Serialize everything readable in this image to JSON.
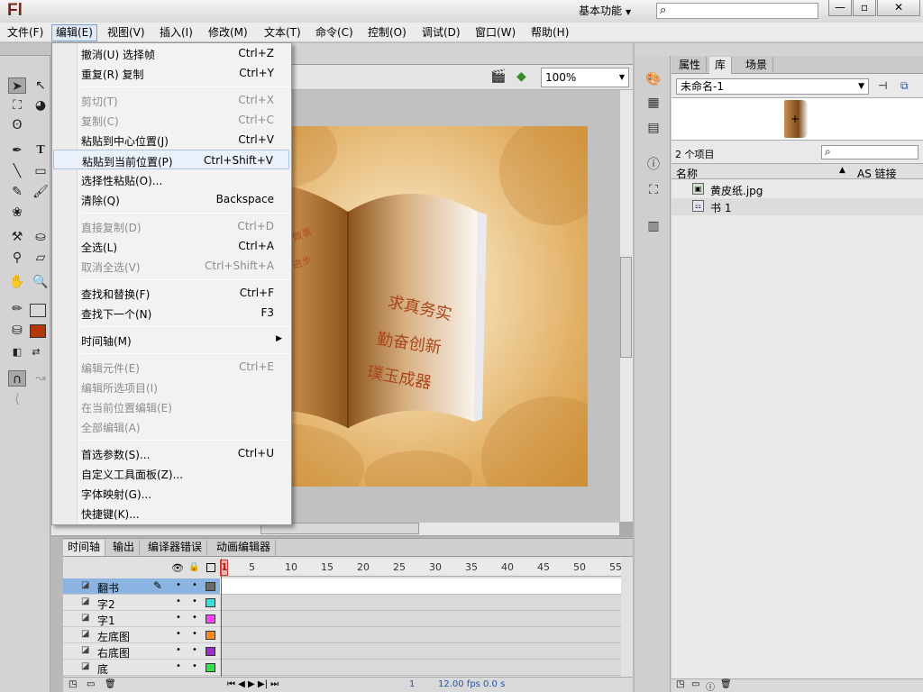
{
  "app": {
    "logo": "Fl",
    "workspace": "基本功能",
    "window_buttons": [
      "—",
      "▫",
      "✕"
    ]
  },
  "menubar": [
    "文件(F)",
    "编辑(E)",
    "视图(V)",
    "插入(I)",
    "修改(M)",
    "文本(T)",
    "命令(C)",
    "控制(O)",
    "调试(D)",
    "窗口(W)",
    "帮助(H)"
  ],
  "edit_menu": {
    "items": [
      {
        "label": "撤消(U) 选择帧",
        "shortcut": "Ctrl+Z",
        "enabled": true
      },
      {
        "label": "重复(R) 复制",
        "shortcut": "Ctrl+Y",
        "enabled": true
      },
      {
        "label": "剪切(T)",
        "shortcut": "Ctrl+X",
        "enabled": false
      },
      {
        "label": "复制(C)",
        "shortcut": "Ctrl+C",
        "enabled": false
      },
      {
        "label": "粘贴到中心位置(J)",
        "shortcut": "Ctrl+V",
        "enabled": true
      },
      {
        "label": "粘贴到当前位置(P)",
        "shortcut": "Ctrl+Shift+V",
        "enabled": true,
        "highlighted": true
      },
      {
        "label": "选择性粘贴(O)...",
        "shortcut": "",
        "enabled": true
      },
      {
        "label": "清除(Q)",
        "shortcut": "Backspace",
        "enabled": true
      },
      {
        "label": "直接复制(D)",
        "shortcut": "Ctrl+D",
        "enabled": false
      },
      {
        "label": "全选(L)",
        "shortcut": "Ctrl+A",
        "enabled": true
      },
      {
        "label": "取消全选(V)",
        "shortcut": "Ctrl+Shift+A",
        "enabled": false
      },
      {
        "label": "查找和替换(F)",
        "shortcut": "Ctrl+F",
        "enabled": true
      },
      {
        "label": "查找下一个(N)",
        "shortcut": "F3",
        "enabled": true
      },
      {
        "label": "时间轴(M)",
        "shortcut": "",
        "enabled": true,
        "submenu": true
      },
      {
        "label": "编辑元件(E)",
        "shortcut": "Ctrl+E",
        "enabled": false
      },
      {
        "label": "编辑所选项目(I)",
        "shortcut": "",
        "enabled": false
      },
      {
        "label": "在当前位置编辑(E)",
        "shortcut": "",
        "enabled": false
      },
      {
        "label": "全部编辑(A)",
        "shortcut": "",
        "enabled": false
      },
      {
        "label": "首选参数(S)...",
        "shortcut": "Ctrl+U",
        "enabled": true
      },
      {
        "label": "自定义工具面板(Z)...",
        "shortcut": "",
        "enabled": true
      },
      {
        "label": "字体映射(G)...",
        "shortcut": "",
        "enabled": true
      },
      {
        "label": "快捷键(K)...",
        "shortcut": "",
        "enabled": true
      }
    ]
  },
  "stage": {
    "zoom": "100%",
    "book_text": [
      "求真务实",
      "勤奋创新",
      "璞玉成器"
    ],
    "left_page_text": [
      "做事",
      "进步"
    ]
  },
  "timeline": {
    "tabs": [
      "时间轴",
      "输出",
      "编译器错误",
      "动画编辑器"
    ],
    "frame_numbers": [
      "1",
      "5",
      "10",
      "15",
      "20",
      "25",
      "30",
      "35",
      "40",
      "45",
      "50",
      "55"
    ],
    "layers": [
      {
        "name": "翻书",
        "color": "#6b6b6b",
        "selected": true
      },
      {
        "name": "字2",
        "color": "#34e0e0",
        "selected": false
      },
      {
        "name": "字1",
        "color": "#ff44ff",
        "selected": false
      },
      {
        "name": "左底图",
        "color": "#ff8a1e",
        "selected": false
      },
      {
        "name": "右底图",
        "color": "#9d2ec9",
        "selected": false
      },
      {
        "name": "底",
        "color": "#33e04a",
        "selected": false
      }
    ],
    "footer": {
      "frame": "1",
      "fps": "12.00 fps",
      "time": "0.0 s"
    }
  },
  "library": {
    "tabs": [
      "属性",
      "库",
      "场景"
    ],
    "document": "未命名-1",
    "item_count": "2 个项目",
    "col_name": "名称",
    "col_link": "AS 链接",
    "items": [
      {
        "name": "黄皮纸.jpg",
        "type": "bitmap-icon"
      },
      {
        "name": "书 1",
        "type": "graphic-symbol-icon"
      }
    ]
  }
}
